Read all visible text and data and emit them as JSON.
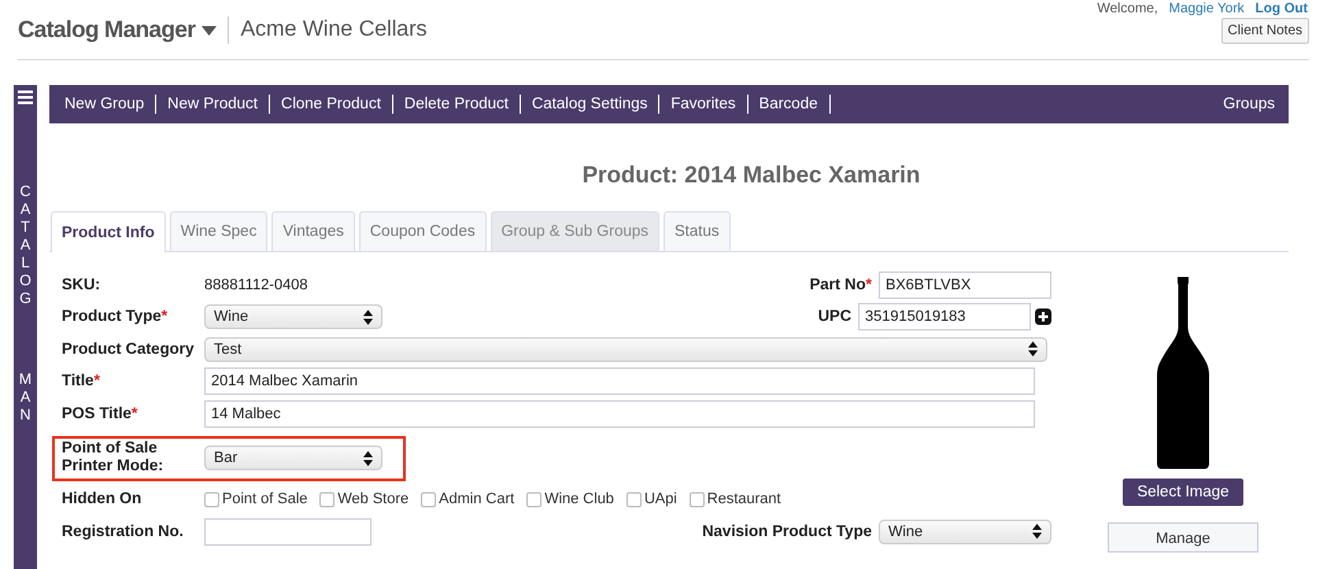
{
  "header": {
    "app_title": "Catalog Manager",
    "store_name": "Acme Wine Cellars",
    "welcome": "Welcome,",
    "user": "Maggie York",
    "logout": "Log Out",
    "client_notes": "Client Notes"
  },
  "sidebar": {
    "words": [
      "CATALOG",
      "MAN"
    ]
  },
  "toolbar": {
    "items": [
      {
        "label": "New Group"
      },
      {
        "label": "New Product"
      },
      {
        "label": "Clone Product"
      },
      {
        "label": "Delete Product"
      },
      {
        "label": "Catalog Settings"
      },
      {
        "label": "Favorites"
      },
      {
        "label": "Barcode"
      }
    ],
    "right_item": "Groups"
  },
  "page_title": "Product: 2014 Malbec Xamarin",
  "tabs": [
    {
      "label": "Product Info",
      "selected": true,
      "disabled": false
    },
    {
      "label": "Wine Spec",
      "selected": false,
      "disabled": false
    },
    {
      "label": "Vintages",
      "selected": false,
      "disabled": false
    },
    {
      "label": "Coupon Codes",
      "selected": false,
      "disabled": false
    },
    {
      "label": "Group & Sub Groups",
      "selected": false,
      "disabled": true
    },
    {
      "label": "Status",
      "selected": false,
      "disabled": false
    }
  ],
  "form": {
    "sku": {
      "label": "SKU:",
      "value": "88881112-0408"
    },
    "part_no": {
      "label": "Part No",
      "mark": "*",
      "value": "BX6BTLVBX"
    },
    "product_type": {
      "label": "Product Type",
      "mark": "*",
      "value": "Wine"
    },
    "upc": {
      "label": "UPC",
      "value": "351915019183"
    },
    "product_category": {
      "label": "Product Category",
      "value": "Test"
    },
    "title": {
      "label": "Title",
      "mark": "*",
      "value": "2014 Malbec Xamarin"
    },
    "pos_title": {
      "label": "POS Title",
      "mark": "*",
      "value": "14 Malbec"
    },
    "printer_mode": {
      "label": "Point of Sale Printer Mode:",
      "value": "Bar",
      "highlighted": true
    },
    "hidden_on": {
      "label": "Hidden On",
      "options": [
        {
          "label": "Point of Sale",
          "checked": false
        },
        {
          "label": "Web Store",
          "checked": false
        },
        {
          "label": "Admin Cart",
          "checked": false
        },
        {
          "label": "Wine Club",
          "checked": false
        },
        {
          "label": "UApi",
          "checked": false
        },
        {
          "label": "Restaurant",
          "checked": false
        }
      ]
    },
    "registration_no": {
      "label": "Registration No."
    },
    "navision_type": {
      "label": "Navision Product Type",
      "value": "Wine"
    }
  },
  "image": {
    "select_button": "Select Image",
    "manage_button": "Manage"
  }
}
